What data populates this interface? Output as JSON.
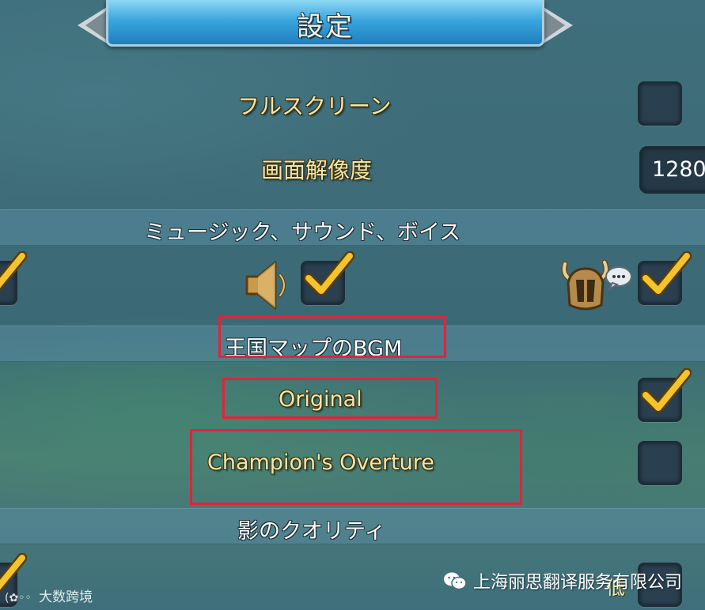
{
  "header": {
    "title": "設定"
  },
  "settings": {
    "fullscreen_label": "フルスクリーン",
    "resolution_label": "画面解像度",
    "resolution_value": "1280",
    "audio_section_label": "ミュージック、サウンド、ボイス",
    "bgm_section_label": "王国マップのBGM",
    "bgm_options": [
      {
        "label": "Original",
        "checked": true
      },
      {
        "label": "Champion's Overture",
        "checked": false
      }
    ],
    "shadow_section_label": "影のクオリティ",
    "shadow_low_label": "低"
  },
  "icons": {
    "sound": "speaker-icon",
    "voice": "helmet-speech-icon",
    "check": "checkmark-icon"
  },
  "watermarks": {
    "left": "大数跨境",
    "right": "上海丽思翻译服务有限公司"
  },
  "colors": {
    "accent_gold": "#f4e6a6",
    "check_gold": "#f5c32a",
    "highlight_red": "#e2233a",
    "banner_blue": "#3aa6dd"
  }
}
